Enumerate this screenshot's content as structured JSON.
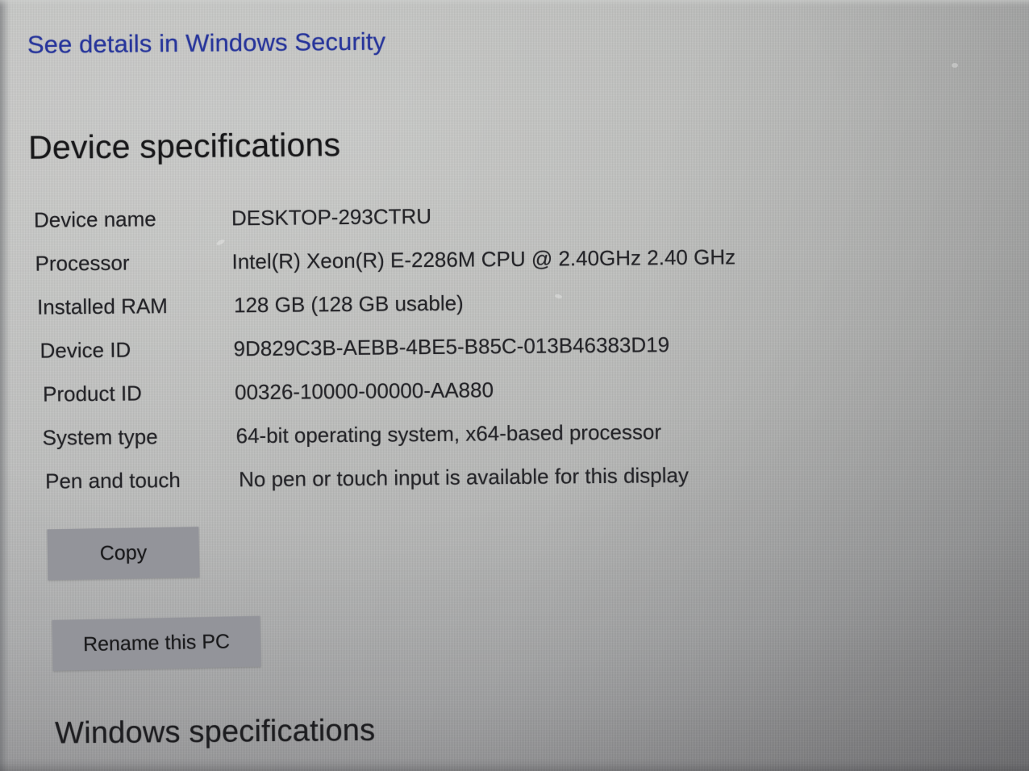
{
  "page": {
    "security_link": "See details in Windows Security",
    "device_section_title": "Device specifications",
    "windows_section_title": "Windows specifications"
  },
  "device_specs": {
    "rows": [
      {
        "label": "Device name",
        "value": "DESKTOP-293CTRU"
      },
      {
        "label": "Processor",
        "value": "Intel(R) Xeon(R) E-2286M  CPU @ 2.40GHz   2.40 GHz"
      },
      {
        "label": "Installed RAM",
        "value": "128 GB (128 GB usable)"
      },
      {
        "label": "Device ID",
        "value": "9D829C3B-AEBB-4BE5-B85C-013B46383D19"
      },
      {
        "label": "Product ID",
        "value": "00326-10000-00000-AA880"
      },
      {
        "label": "System type",
        "value": "64-bit operating system, x64-based processor"
      },
      {
        "label": "Pen and touch",
        "value": "No pen or touch input is available for this display"
      }
    ]
  },
  "buttons": {
    "copy": "Copy",
    "rename": "Rename this PC"
  },
  "colors": {
    "link": "#27359b",
    "text": "#222226",
    "heading": "#18181a",
    "button_fill": "#93949a",
    "background": "#b9bab8"
  }
}
